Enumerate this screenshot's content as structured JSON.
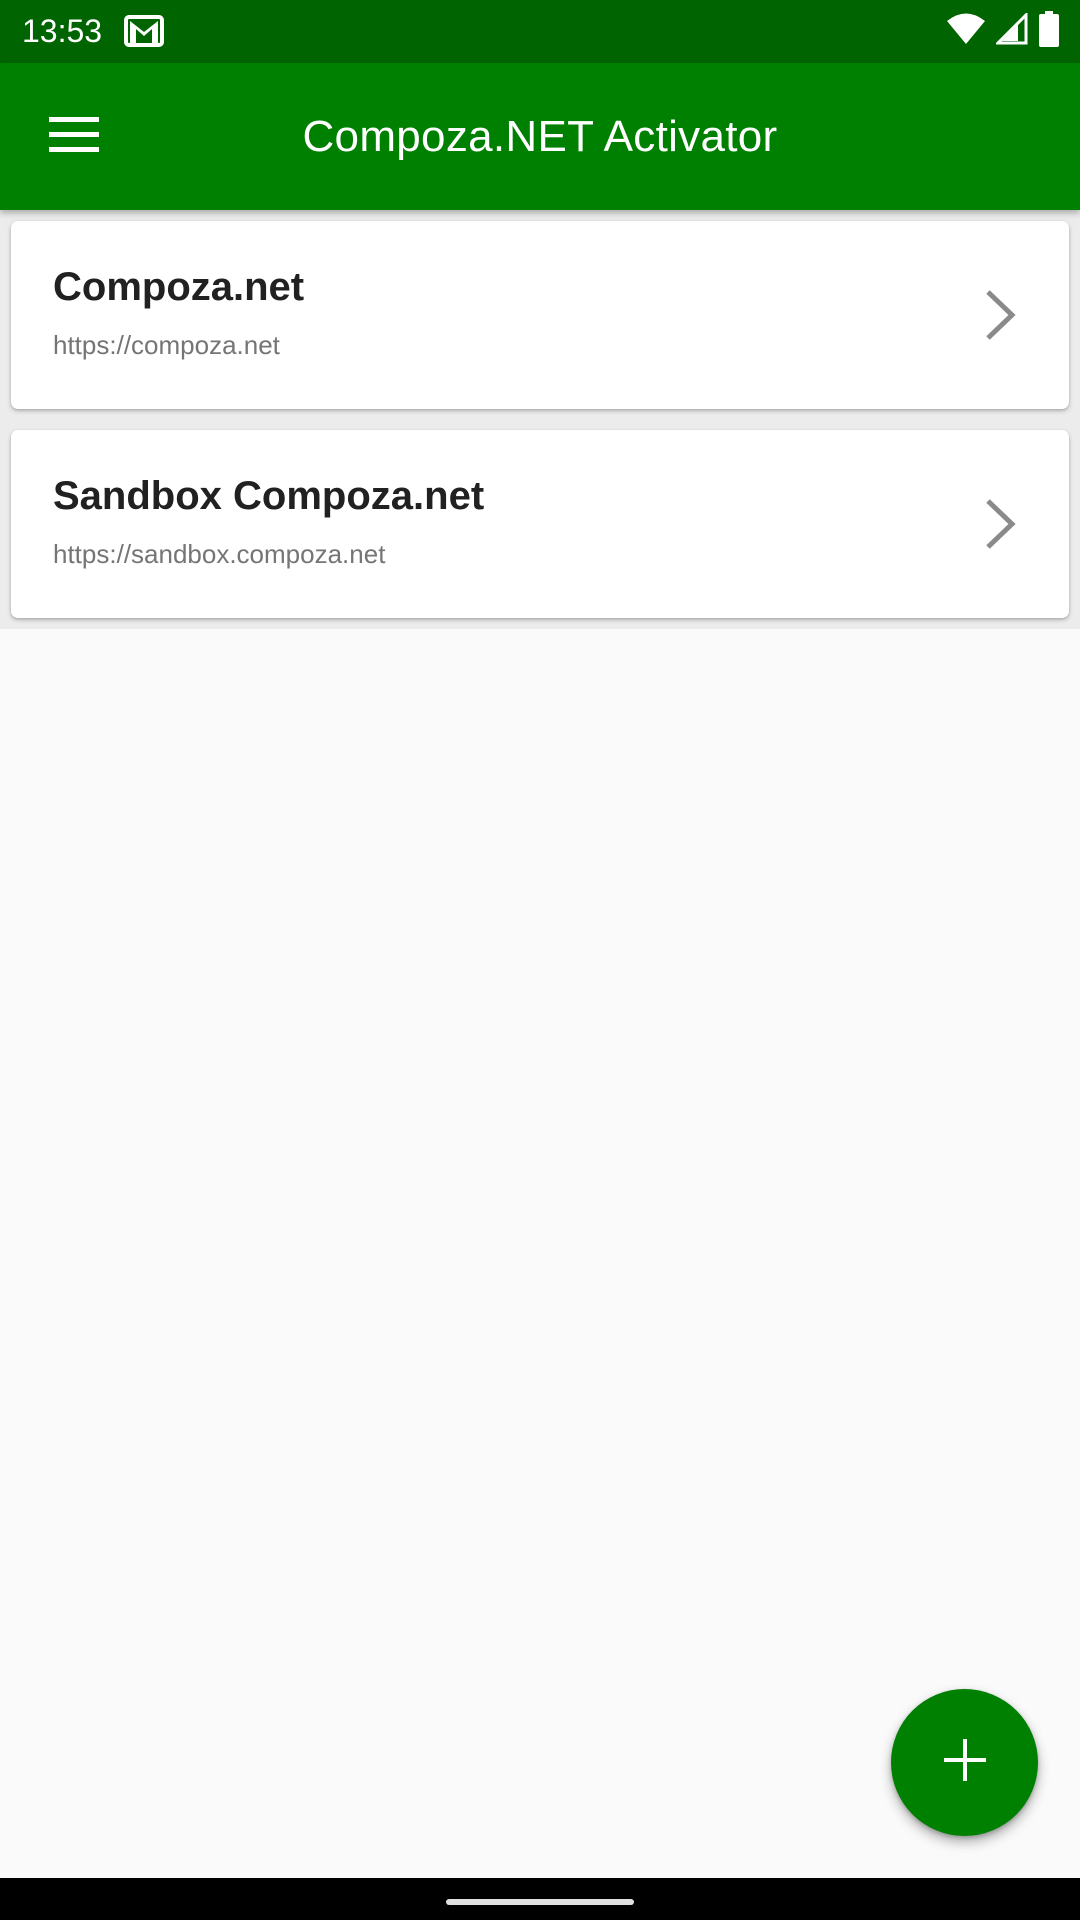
{
  "status_bar": {
    "time": "13:53",
    "icons": [
      "gmail-icon",
      "wifi-icon",
      "signal-icon",
      "battery-icon"
    ]
  },
  "app_bar": {
    "title": "Compoza.NET Activator",
    "menu_icon": "hamburger-menu-icon",
    "background_color": "#008000"
  },
  "servers": [
    {
      "title": "Compoza.net",
      "url": "https://compoza.net"
    },
    {
      "title": "Sandbox Compoza.net",
      "url": "https://sandbox.compoza.net"
    }
  ],
  "fab": {
    "icon": "plus-icon",
    "color": "#008000"
  },
  "colors": {
    "status_bar": "#006400",
    "accent": "#008000",
    "background": "#fafafa"
  }
}
